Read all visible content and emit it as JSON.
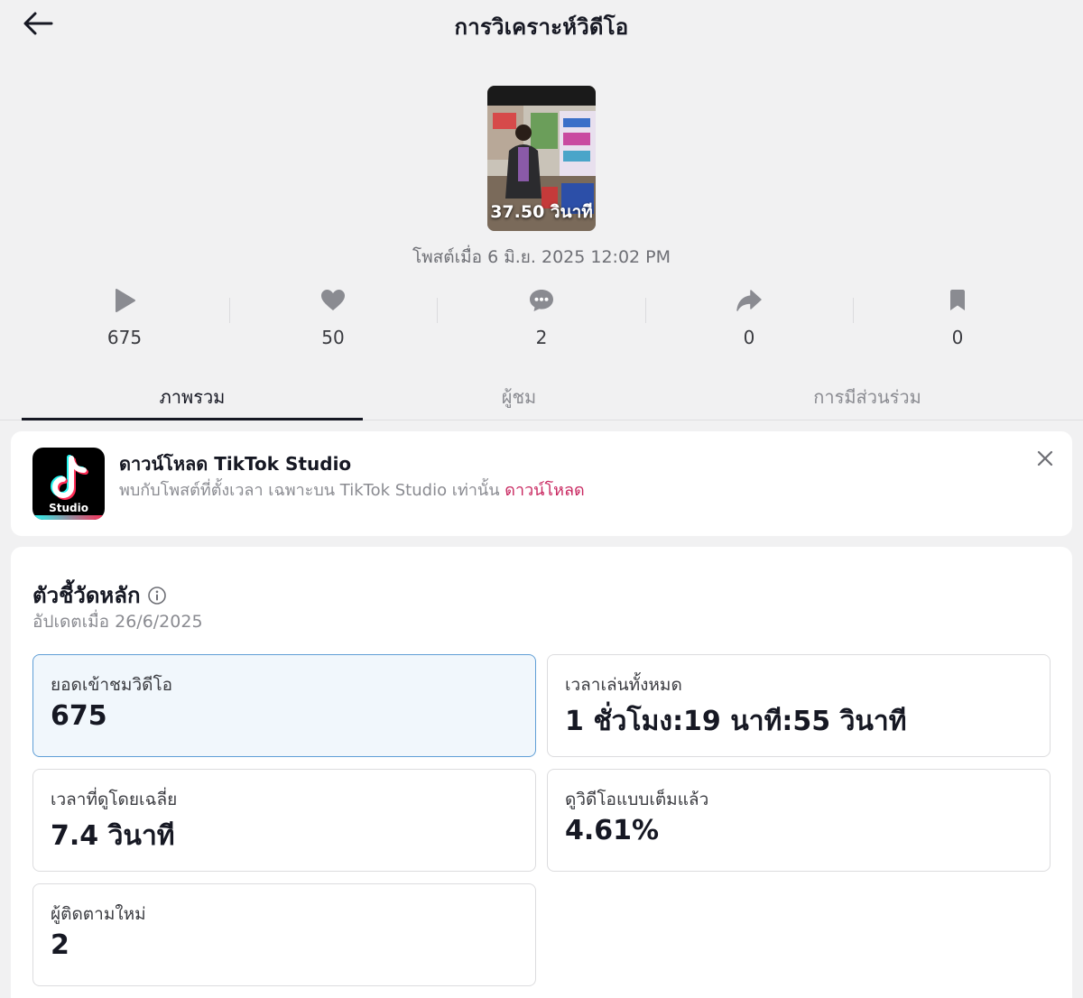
{
  "header": {
    "title": "การวิเคราะห์วิดีโอ"
  },
  "video": {
    "duration": "37.50 วินาที",
    "posted": "โพสต์เมื่อ 6 มิ.ย. 2025 12:02 PM"
  },
  "stats": [
    {
      "icon": "play-icon",
      "value": "675"
    },
    {
      "icon": "heart-icon",
      "value": "50"
    },
    {
      "icon": "comment-icon",
      "value": "2"
    },
    {
      "icon": "share-icon",
      "value": "0"
    },
    {
      "icon": "bookmark-icon",
      "value": "0"
    }
  ],
  "tabs": [
    {
      "label": "ภาพรวม",
      "active": true
    },
    {
      "label": "ผู้ชม",
      "active": false
    },
    {
      "label": "การมีส่วนร่วม",
      "active": false
    }
  ],
  "banner": {
    "logo_text": "Studio",
    "title": "ดาวน์โหลด TikTok Studio",
    "description": "พบกับโพสต์ที่ตั้งเวลา เฉพาะบน TikTok Studio เท่านั้น",
    "link": "ดาวน์โหลด"
  },
  "metrics": {
    "title": "ตัวชี้วัดหลัก",
    "updated": "อัปเดตเมื่อ 26/6/2025",
    "items": [
      {
        "label": "ยอดเข้าชมวิดีโอ",
        "value": "675"
      },
      {
        "label": "เวลาเล่นทั้งหมด",
        "value": "1 ชั่วโมง:19 นาที:55 วินาที"
      },
      {
        "label": "เวลาที่ดูโดยเฉลี่ย",
        "value": "7.4 วินาที"
      },
      {
        "label": "ดูวิดีโอแบบเต็มแล้ว",
        "value": "4.61%"
      },
      {
        "label": "ผู้ติดตามใหม่",
        "value": "2"
      }
    ]
  },
  "colors": {
    "accent_link": "#c8265f",
    "selected_border": "#5f9ed6",
    "selected_bg": "#f1f7fc"
  }
}
